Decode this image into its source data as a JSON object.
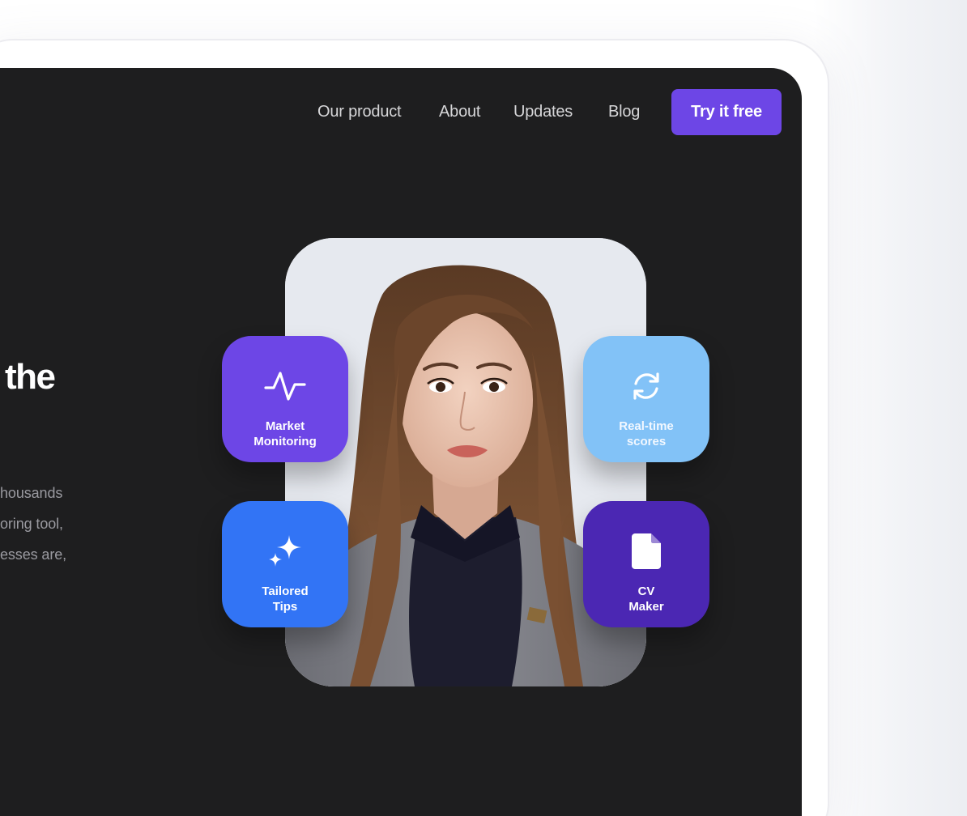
{
  "nav": {
    "links": [
      "Our product",
      "About",
      "Updates",
      "Blog"
    ],
    "cta_label": "Try it free"
  },
  "hero": {
    "title_fragment": "the",
    "body_lines": [
      "housands",
      "oring tool,",
      "esses are,"
    ]
  },
  "features": [
    {
      "label": "Market\nMonitoring",
      "icon": "pulse-icon",
      "color": "#6d46e6"
    },
    {
      "label": "Real-time\nscores",
      "icon": "refresh-icon",
      "color": "#82c2f7"
    },
    {
      "label": "Tailored\nTips",
      "icon": "sparkle-icon",
      "color": "#3274f5"
    },
    {
      "label": "CV\nMaker",
      "icon": "document-icon",
      "color": "#4b27b3"
    }
  ],
  "colors": {
    "background": "#1e1e1f",
    "accent": "#6d46e6"
  }
}
